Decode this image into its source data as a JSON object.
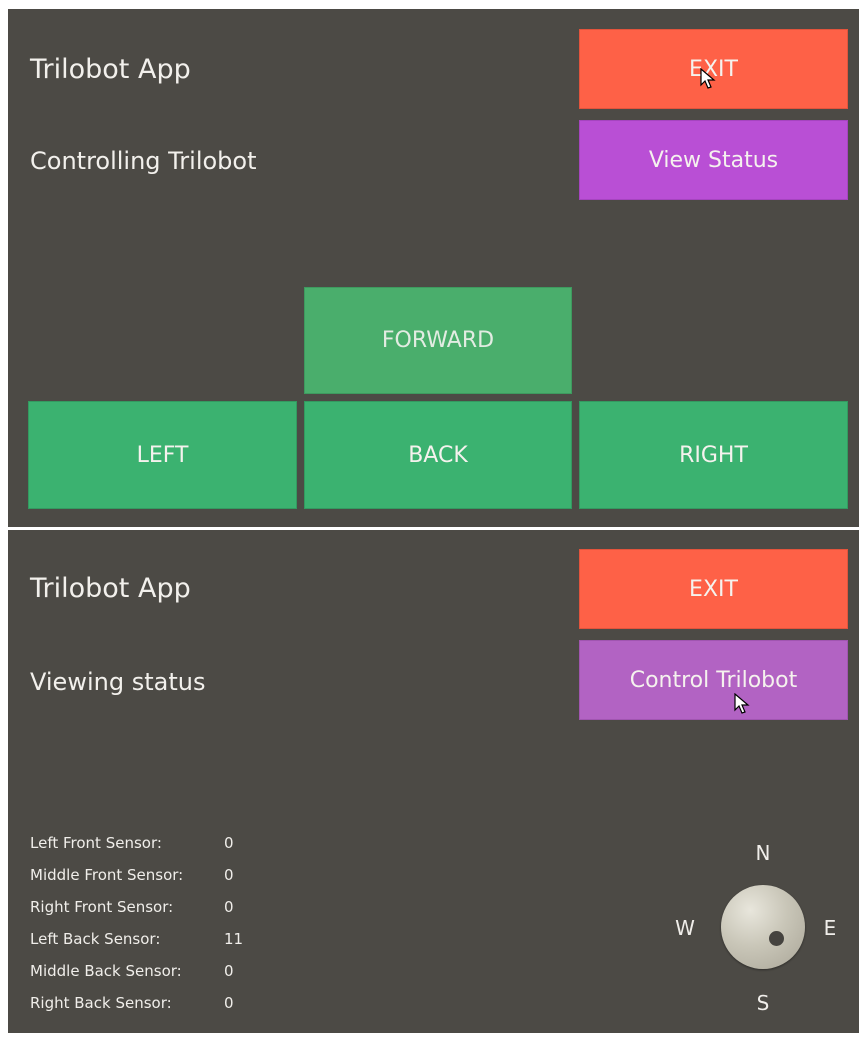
{
  "control_view": {
    "app_title": "Trilobot App",
    "mode_label": "Controlling Trilobot",
    "exit_label": "EXIT",
    "switch_label": "View Status",
    "forward_label": "FORWARD",
    "left_label": "LEFT",
    "back_label": "BACK",
    "right_label": "RIGHT"
  },
  "status_view": {
    "app_title": "Trilobot App",
    "mode_label": "Viewing status",
    "exit_label": "EXIT",
    "switch_label": "Control Trilobot",
    "sensors": [
      {
        "label": "Left Front Sensor:",
        "value": "0"
      },
      {
        "label": "Middle Front Sensor:",
        "value": "0"
      },
      {
        "label": "Right Front Sensor:",
        "value": "0"
      },
      {
        "label": "Left Back Sensor:",
        "value": "11"
      },
      {
        "label": "Middle Back Sensor:",
        "value": "0"
      },
      {
        "label": "Right Back Sensor:",
        "value": "0"
      }
    ],
    "compass": {
      "north": "N",
      "south": "S",
      "east": "E",
      "west": "W"
    }
  },
  "colors": {
    "background": "#4c4a45",
    "exit": "#fe6147",
    "purple": "#b94fd5",
    "green": "#3bb270"
  },
  "icons": {
    "cursor": "mouse-pointer-icon",
    "compass_knob": "compass-dial-icon"
  }
}
